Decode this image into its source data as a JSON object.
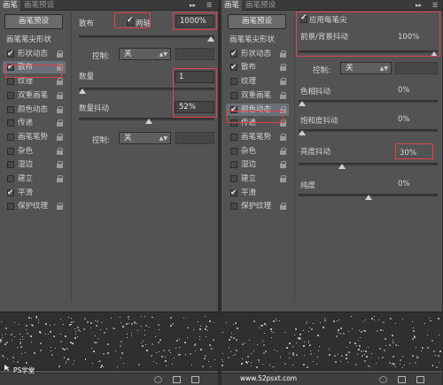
{
  "left_panel": {
    "tabs": [
      {
        "label": "画笔"
      },
      {
        "label": "画笔预设"
      }
    ],
    "preset_button": "画笔预设",
    "brush_items": [
      {
        "label": "画笔笔尖形状",
        "header": true
      },
      {
        "label": "形状动态",
        "checked": true
      },
      {
        "label": "散布",
        "checked": true,
        "selected": true
      },
      {
        "label": "纹理",
        "checked": false
      },
      {
        "label": "双重画笔",
        "checked": false
      },
      {
        "label": "颜色动态",
        "checked": false
      },
      {
        "label": "传递",
        "checked": false
      },
      {
        "label": "画笔笔势",
        "checked": false
      },
      {
        "label": "杂色",
        "checked": false
      },
      {
        "label": "湿边",
        "checked": false
      },
      {
        "label": "建立",
        "checked": false
      },
      {
        "label": "平滑",
        "checked": true
      },
      {
        "label": "保护纹理",
        "checked": false
      }
    ],
    "scatter_label": "散布",
    "both_axes_label": "两轴",
    "both_axes_checked": true,
    "scatter_value": "1000%",
    "scatter_level": 1.0,
    "control1_label": "控制:",
    "control1_value": "关",
    "count_label": "数量",
    "count_value": "1",
    "count_level": 0.0,
    "count_jitter_label": "数量抖动",
    "count_jitter_value": "52%",
    "count_jitter_level": 0.52,
    "control2_label": "控制:",
    "control2_value": "关"
  },
  "right_panel": {
    "tabs": [
      {
        "label": "画笔"
      },
      {
        "label": "画笔预设"
      }
    ],
    "preset_button": "画笔预设",
    "brush_items": [
      {
        "label": "画笔笔尖形状",
        "header": true
      },
      {
        "label": "形状动态",
        "checked": true
      },
      {
        "label": "散布",
        "checked": true
      },
      {
        "label": "纹理",
        "checked": false
      },
      {
        "label": "双重画笔",
        "checked": false
      },
      {
        "label": "颜色动态",
        "checked": true,
        "selected": true
      },
      {
        "label": "传递",
        "checked": false
      },
      {
        "label": "画笔笔势",
        "checked": false
      },
      {
        "label": "杂色",
        "checked": false
      },
      {
        "label": "湿边",
        "checked": false
      },
      {
        "label": "建立",
        "checked": false
      },
      {
        "label": "平滑",
        "checked": true
      },
      {
        "label": "保护纹理",
        "checked": false
      }
    ],
    "apply_per_tip_label": "应用每笔尖",
    "apply_per_tip_checked": true,
    "fg_bg_jitter_label": "前景/背景抖动",
    "fg_bg_jitter_value": "100%",
    "fg_bg_jitter_level": 1.0,
    "control_label": "控制:",
    "control_value": "关",
    "hue_jitter_label": "色相抖动",
    "hue_jitter_value": "0%",
    "hue_jitter_level": 0.0,
    "saturation_jitter_label": "饱和度抖动",
    "saturation_jitter_value": "0%",
    "saturation_jitter_level": 0.0,
    "brightness_jitter_label": "亮度抖动",
    "brightness_jitter_value": "30%",
    "brightness_jitter_level": 0.3,
    "purity_label": "纯度",
    "purity_value": "0%",
    "purity_level": 0.5
  },
  "watermark_left": "PS学堂",
  "watermark_right": "www.52psxt.com",
  "icons": {
    "menu": "panel-menu-icon",
    "collapse": "double-arrow-icon",
    "lock": "lock-icon",
    "new": "new-preset-icon",
    "grid": "grid-icon"
  },
  "colors": {
    "highlight": "#e0414a",
    "panel": "#535353",
    "selected_row": "#6b6f78"
  }
}
